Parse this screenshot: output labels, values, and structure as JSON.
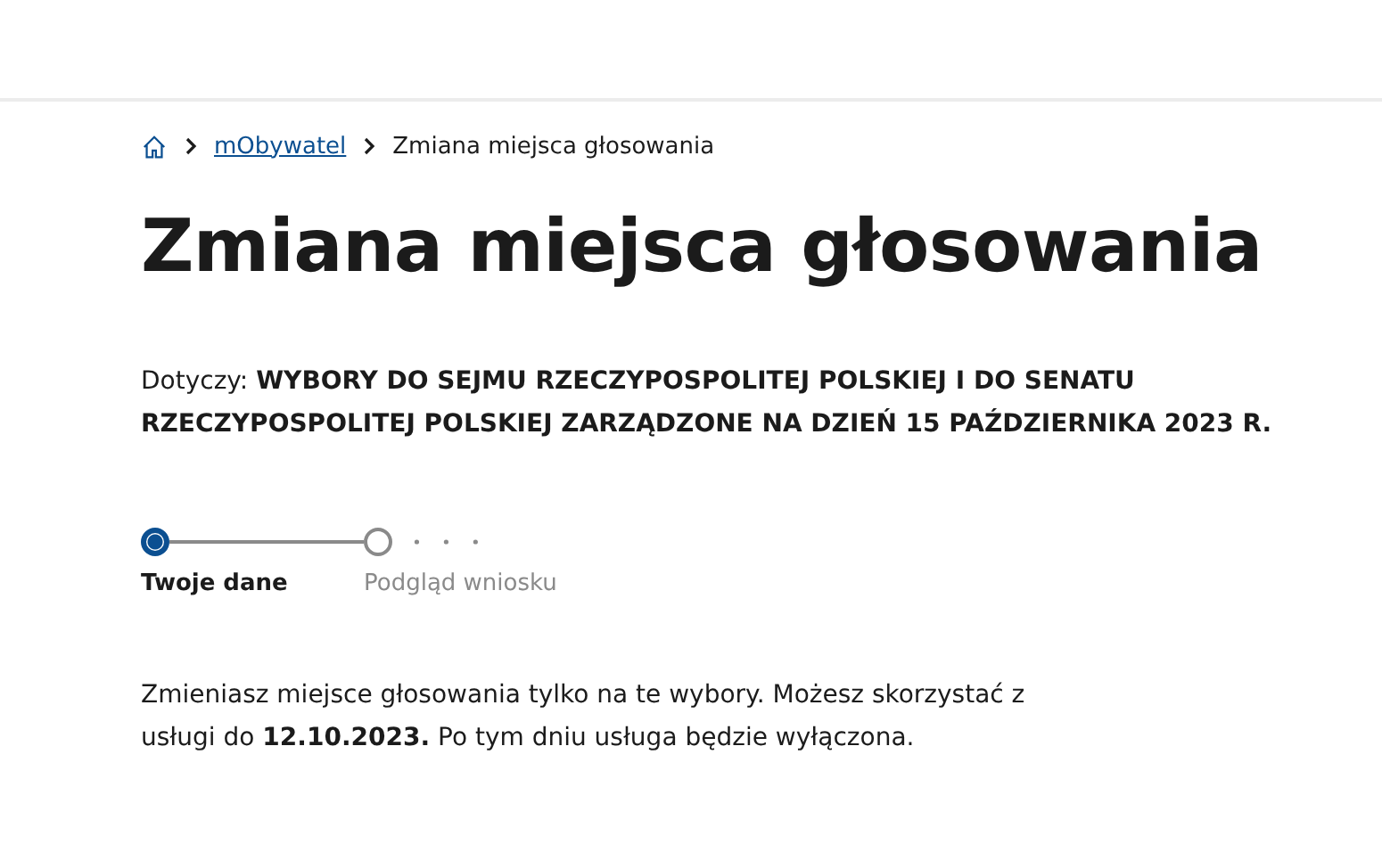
{
  "breadcrumb": [
    {
      "kind": "home"
    },
    {
      "kind": "link",
      "label": "mObywatel"
    },
    {
      "kind": "current",
      "label": "Zmiana miejsca głosowania"
    }
  ],
  "title": "Zmiana miejsca głosowania",
  "subject": "Dotyczy: **WYBORY DO SEJMU RZECZYPOSPOLITEJ POLSKIEJ I DO SENATU RZECZYPOSPOLITEJ POLSKIEJ ZARZĄDZONE NA DZIEŃ 15 PAŹDZIERNIKA 2023 R.**",
  "steps": [
    {
      "label": "Twoje dane",
      "selected": true
    },
    {
      "label": "Podgląd wniosku",
      "selected": false
    }
  ],
  "info": "Zmieniasz miejsce głosowania tylko na te wybory. Możesz skorzystać z usługi do **12.10.2023.** Po tym dniu usługa będzie wyłączona."
}
